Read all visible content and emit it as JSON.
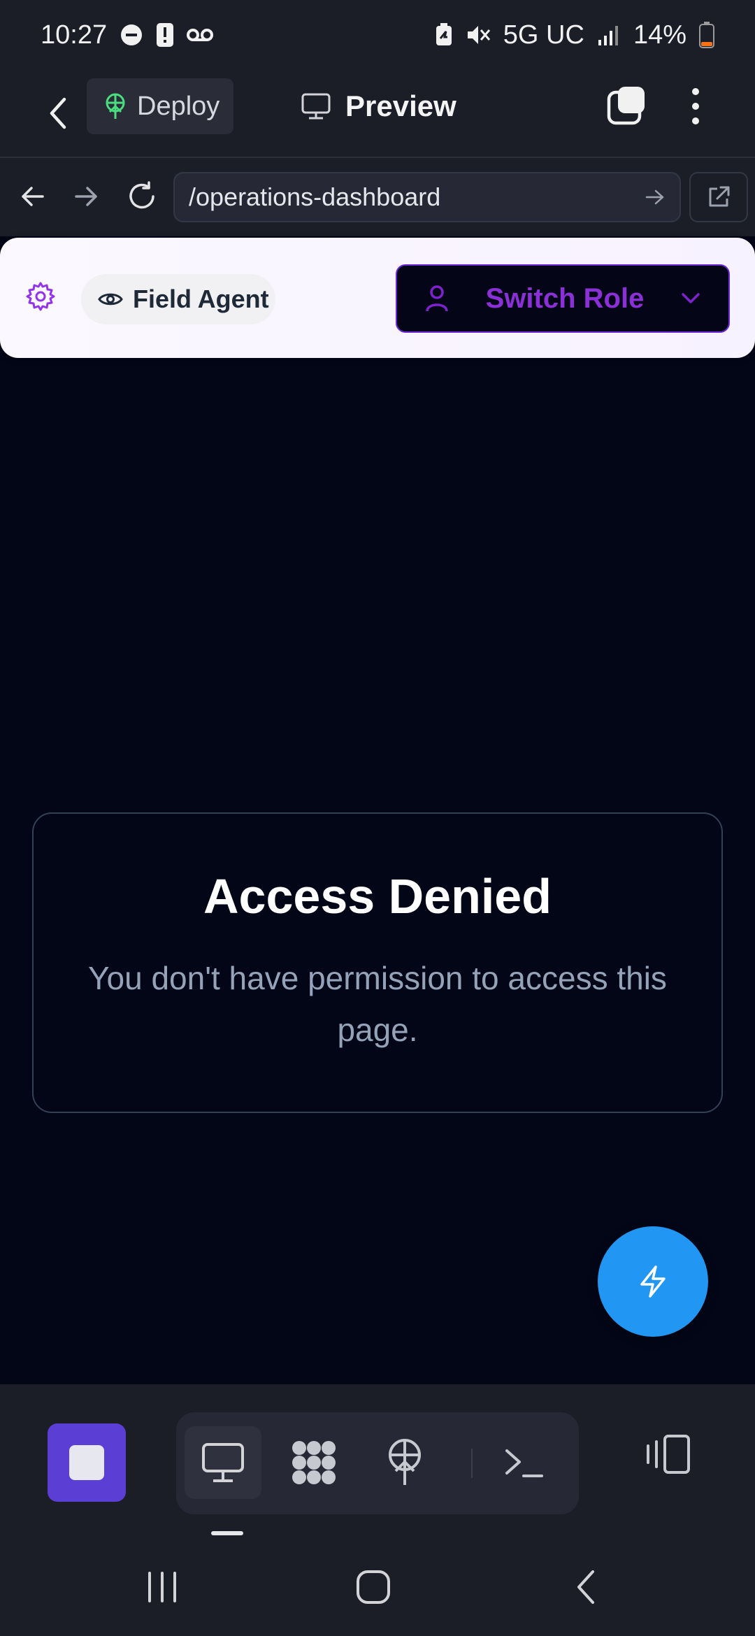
{
  "status_bar": {
    "time": "10:27",
    "network": "5G UC",
    "battery": "14%"
  },
  "app_header": {
    "deploy_label": "Deploy",
    "preview_label": "Preview"
  },
  "url_bar": {
    "url": "/operations-dashboard"
  },
  "role_bar": {
    "current_role": "Field Agent",
    "switch_label": "Switch Role"
  },
  "access_denied": {
    "title": "Access Denied",
    "message": "You don't have permission to access this page."
  },
  "toolbar": {
    "tools": [
      "preview",
      "apps",
      "deploy",
      "terminal"
    ],
    "active_tool": "preview"
  },
  "colors": {
    "accent": "#5b3fd4",
    "fab": "#2196f3",
    "role_purple": "#8b2fd6",
    "deploy_green": "#4ade80"
  }
}
